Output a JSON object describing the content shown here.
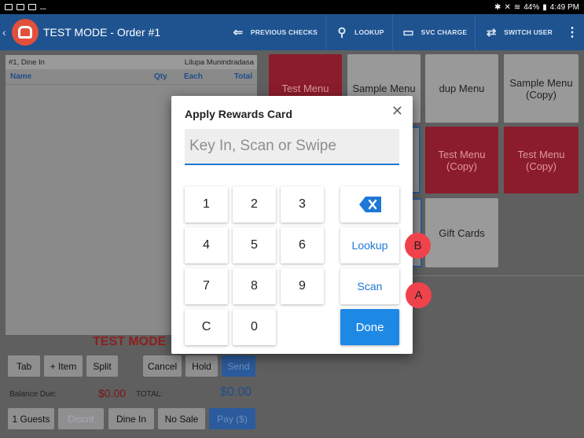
{
  "status_bar": {
    "battery": "44%",
    "time": "4:49 PM"
  },
  "app_bar": {
    "title": "TEST MODE - Order #1",
    "actions": [
      {
        "label": "PREVIOUS CHECKS",
        "icon": "previous-checks-icon"
      },
      {
        "label": "LOOKUP",
        "icon": "search-icon"
      },
      {
        "label": "SVC CHARGE",
        "icon": "service-charge-icon"
      },
      {
        "label": "SWITCH USER",
        "icon": "switch-user-icon"
      }
    ]
  },
  "order": {
    "order_info": "#1, Dine In",
    "server": "Lilupa Munindradasa",
    "columns": [
      "Name",
      "Qty",
      "Each",
      "Total"
    ],
    "mode_banner": "TEST MODE",
    "buttons_row1": [
      "Tab",
      "+ Item",
      "Split",
      "Cancel",
      "Hold",
      "Send"
    ],
    "balance_label": "Balance Due:",
    "balance_value": "$0.00",
    "total_label": "TOTAL:",
    "total_value": "$0.00",
    "buttons_row2": [
      "1 Guests",
      "Discnt",
      "Dine In",
      "No Sale",
      "Pay ($)"
    ]
  },
  "menu_tiles": [
    {
      "label": "Test Menu"
    },
    {
      "label": "Sample Menu"
    },
    {
      "label": "dup Menu"
    },
    {
      "label": "Sample Menu (Copy)"
    },
    {
      "label": "Test Menu (Copy)"
    },
    {
      "label": "Test Menu (Copy)"
    },
    {
      "label": "Gift Cards"
    }
  ],
  "modal": {
    "title": "Apply Rewards Card",
    "input_placeholder": "Key In, Scan or Swipe",
    "keys": [
      "1",
      "2",
      "3",
      "4",
      "5",
      "6",
      "7",
      "8",
      "9",
      "C",
      "0"
    ],
    "lookup_label": "Lookup",
    "scan_label": "Scan",
    "done_label": "Done"
  },
  "callouts": {
    "a": "A",
    "b": "B"
  },
  "colors": {
    "app_bar": "#1f5390",
    "accent_blue": "#1e88e5",
    "callout": "#f0424b",
    "test_mode_red": "#8d1f1f"
  }
}
